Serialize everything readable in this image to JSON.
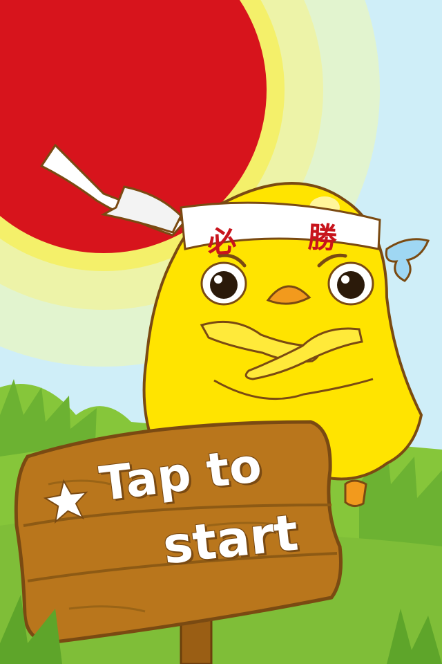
{
  "screen": {
    "name": "title-screen",
    "start_prompt": {
      "line1": "Tap to",
      "line2": "start"
    },
    "headband_text": {
      "char1": "必",
      "char2": "勝"
    }
  },
  "colors": {
    "sky": "#cfeef8",
    "sun": "#d7141c",
    "sun_glow_inner": "#f4f06a",
    "sun_glow_outer": "#e6f6b8",
    "grass": "#86c63a",
    "grass_dark": "#5ea52a",
    "chick_body": "#ffe400",
    "chick_outline": "#7a4a12",
    "beak": "#f29a1d",
    "sign_wood": "#b9761c",
    "sign_wood_dark": "#8d5a14",
    "headband": "#ffffff",
    "headband_text": "#c8141c",
    "sweat_drop": "#9fd7f3"
  },
  "icons": {
    "start_star": "star-icon"
  }
}
